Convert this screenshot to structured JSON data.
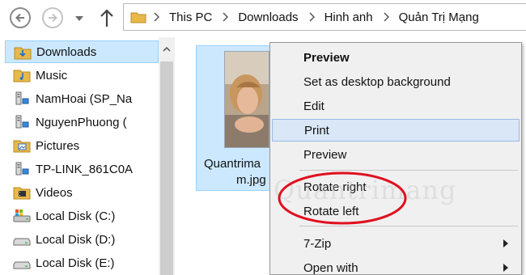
{
  "address_bar": {
    "breadcrumbs": [
      "This PC",
      "Downloads",
      "Hinh anh",
      "Quản Trị Mạng"
    ]
  },
  "nav_pane": {
    "items": [
      {
        "label": "Downloads",
        "icon": "downloads-folder-icon",
        "selected": true
      },
      {
        "label": "Music",
        "icon": "music-folder-icon"
      },
      {
        "label": "NamHoai (SP_Na",
        "icon": "network-computer-icon"
      },
      {
        "label": "NguyenPhuong (",
        "icon": "network-computer-icon"
      },
      {
        "label": "Pictures",
        "icon": "pictures-folder-icon"
      },
      {
        "label": "TP-LINK_861C0A",
        "icon": "network-computer-icon"
      },
      {
        "label": "Videos",
        "icon": "videos-folder-icon"
      },
      {
        "label": "Local Disk (C:)",
        "icon": "system-drive-icon"
      },
      {
        "label": "Local Disk (D:)",
        "icon": "drive-icon"
      },
      {
        "label": "Local Disk (E:)",
        "icon": "drive-icon"
      }
    ]
  },
  "file": {
    "name_line1": "Quantrima",
    "name_line2": "m.jpg"
  },
  "context_menu": {
    "items": [
      {
        "label": "Preview",
        "bold": true
      },
      {
        "label": "Set as desktop background"
      },
      {
        "label": "Edit"
      },
      {
        "label": "Print",
        "hover": true
      },
      {
        "label": "Preview"
      },
      {
        "label": "Rotate right"
      },
      {
        "label": "Rotate left"
      },
      {
        "label": "7-Zip",
        "submenu": true
      },
      {
        "label": "Open with",
        "submenu": true
      }
    ]
  },
  "watermark": "Quantrimang",
  "colors": {
    "selection_fill": "#cce8ff",
    "selection_border": "#99d1ff",
    "menu_background": "#f0f0f0",
    "menu_hover": "#d9e7f6",
    "annotation_ellipse": "#e01020",
    "folder_yellow": "#e8b94a"
  }
}
